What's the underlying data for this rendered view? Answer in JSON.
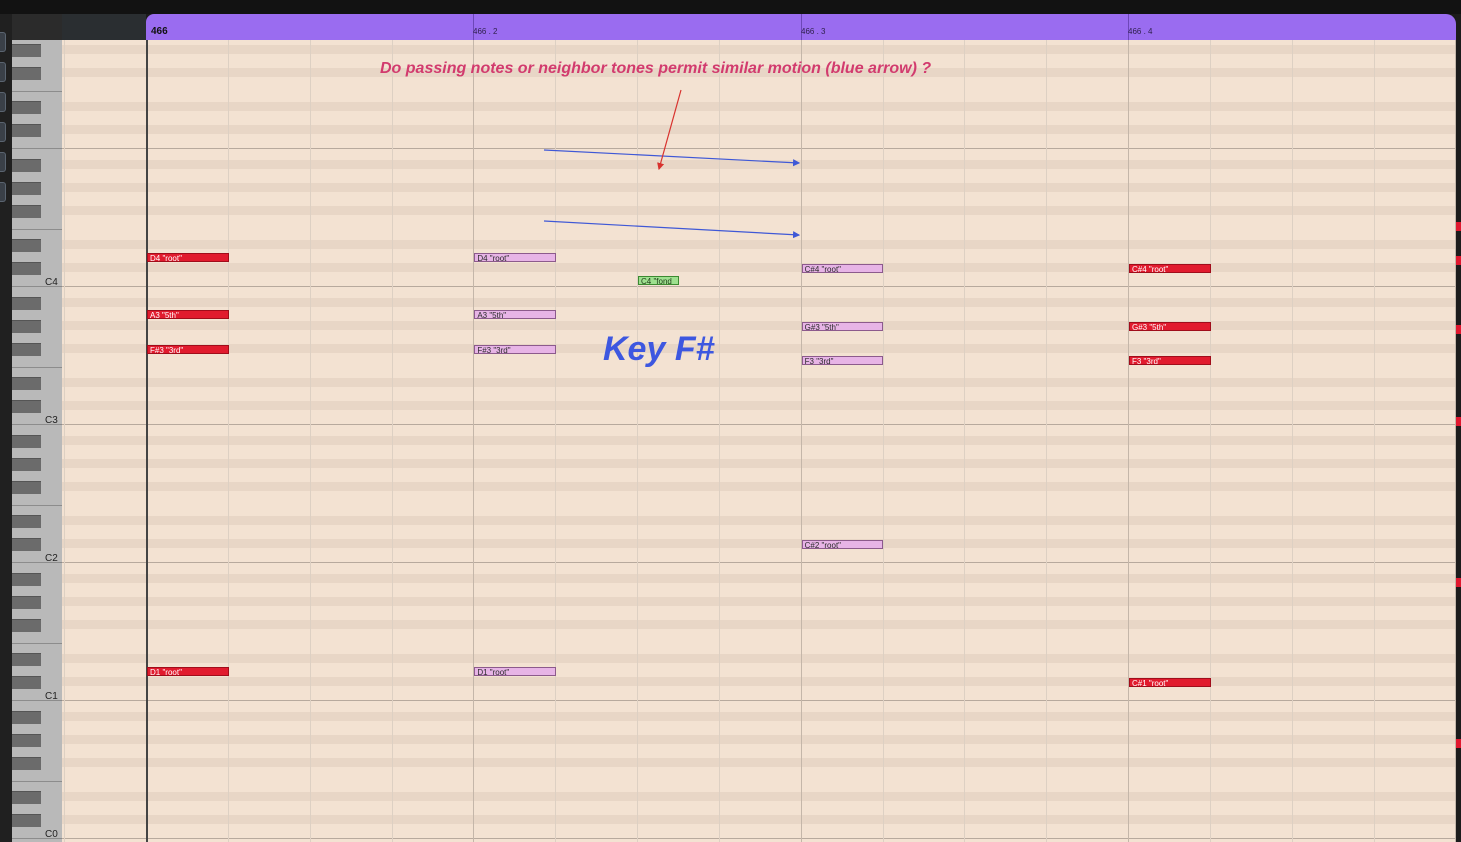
{
  "ruler": {
    "bar_label": "466",
    "beat_labels": [
      "466 . 2",
      "466 . 3",
      "466 . 4"
    ],
    "color": "#9a6cf0"
  },
  "keyboard": {
    "octave_labels": [
      "C4",
      "C3",
      "C2",
      "C1",
      "C0"
    ]
  },
  "notes": [
    {
      "label": "D4 \"root\"",
      "pitch": "D4",
      "start": 1.0,
      "length": 0.25,
      "style": "red"
    },
    {
      "label": "A3 \"5th\"",
      "pitch": "A3",
      "start": 1.0,
      "length": 0.25,
      "style": "red"
    },
    {
      "label": "F#3 \"3rd\"",
      "pitch": "F#3",
      "start": 1.0,
      "length": 0.25,
      "style": "red"
    },
    {
      "label": "D1 \"root\"",
      "pitch": "D1",
      "start": 1.0,
      "length": 0.25,
      "style": "red"
    },
    {
      "label": "D4 \"root\"",
      "pitch": "D4",
      "start": 2.0,
      "length": 0.25,
      "style": "pink"
    },
    {
      "label": "A3 \"5th\"",
      "pitch": "A3",
      "start": 2.0,
      "length": 0.25,
      "style": "pink"
    },
    {
      "label": "F#3 \"3rd\"",
      "pitch": "F#3",
      "start": 2.0,
      "length": 0.25,
      "style": "pink"
    },
    {
      "label": "D1 \"root\"",
      "pitch": "D1",
      "start": 2.0,
      "length": 0.25,
      "style": "pink"
    },
    {
      "label": "C4 \"fond",
      "pitch": "C4",
      "start": 2.5,
      "length": 0.125,
      "style": "green"
    },
    {
      "label": "C#4 \"root\"",
      "pitch": "C#4",
      "start": 3.0,
      "length": 0.25,
      "style": "pink"
    },
    {
      "label": "G#3 \"5th\"",
      "pitch": "G#3",
      "start": 3.0,
      "length": 0.25,
      "style": "pink"
    },
    {
      "label": "F3 \"3rd\"",
      "pitch": "F3",
      "start": 3.0,
      "length": 0.25,
      "style": "pink"
    },
    {
      "label": "C#2 \"root\"",
      "pitch": "C#2",
      "start": 3.0,
      "length": 0.25,
      "style": "pink"
    },
    {
      "label": "C#4 \"root\"",
      "pitch": "C#4",
      "start": 4.0,
      "length": 0.25,
      "style": "red"
    },
    {
      "label": "G#3 \"5th\"",
      "pitch": "G#3",
      "start": 4.0,
      "length": 0.25,
      "style": "red"
    },
    {
      "label": "F3 \"3rd\"",
      "pitch": "F3",
      "start": 4.0,
      "length": 0.25,
      "style": "red"
    },
    {
      "label": "C#1 \"root\"",
      "pitch": "C#1",
      "start": 4.0,
      "length": 0.25,
      "style": "red"
    }
  ],
  "annotations": {
    "question": "Do passing notes or neighbor tones permit similar motion (blue arrow) ?",
    "key": "Key F#",
    "arrow_blue_color": "#3f58d6",
    "arrow_red_color": "#d8322e"
  },
  "colors": {
    "note_red": "#e11b2e",
    "note_pink": "#e7b4e6",
    "note_green": "#9ee08f",
    "grid_bg": "#f3e2d2"
  }
}
